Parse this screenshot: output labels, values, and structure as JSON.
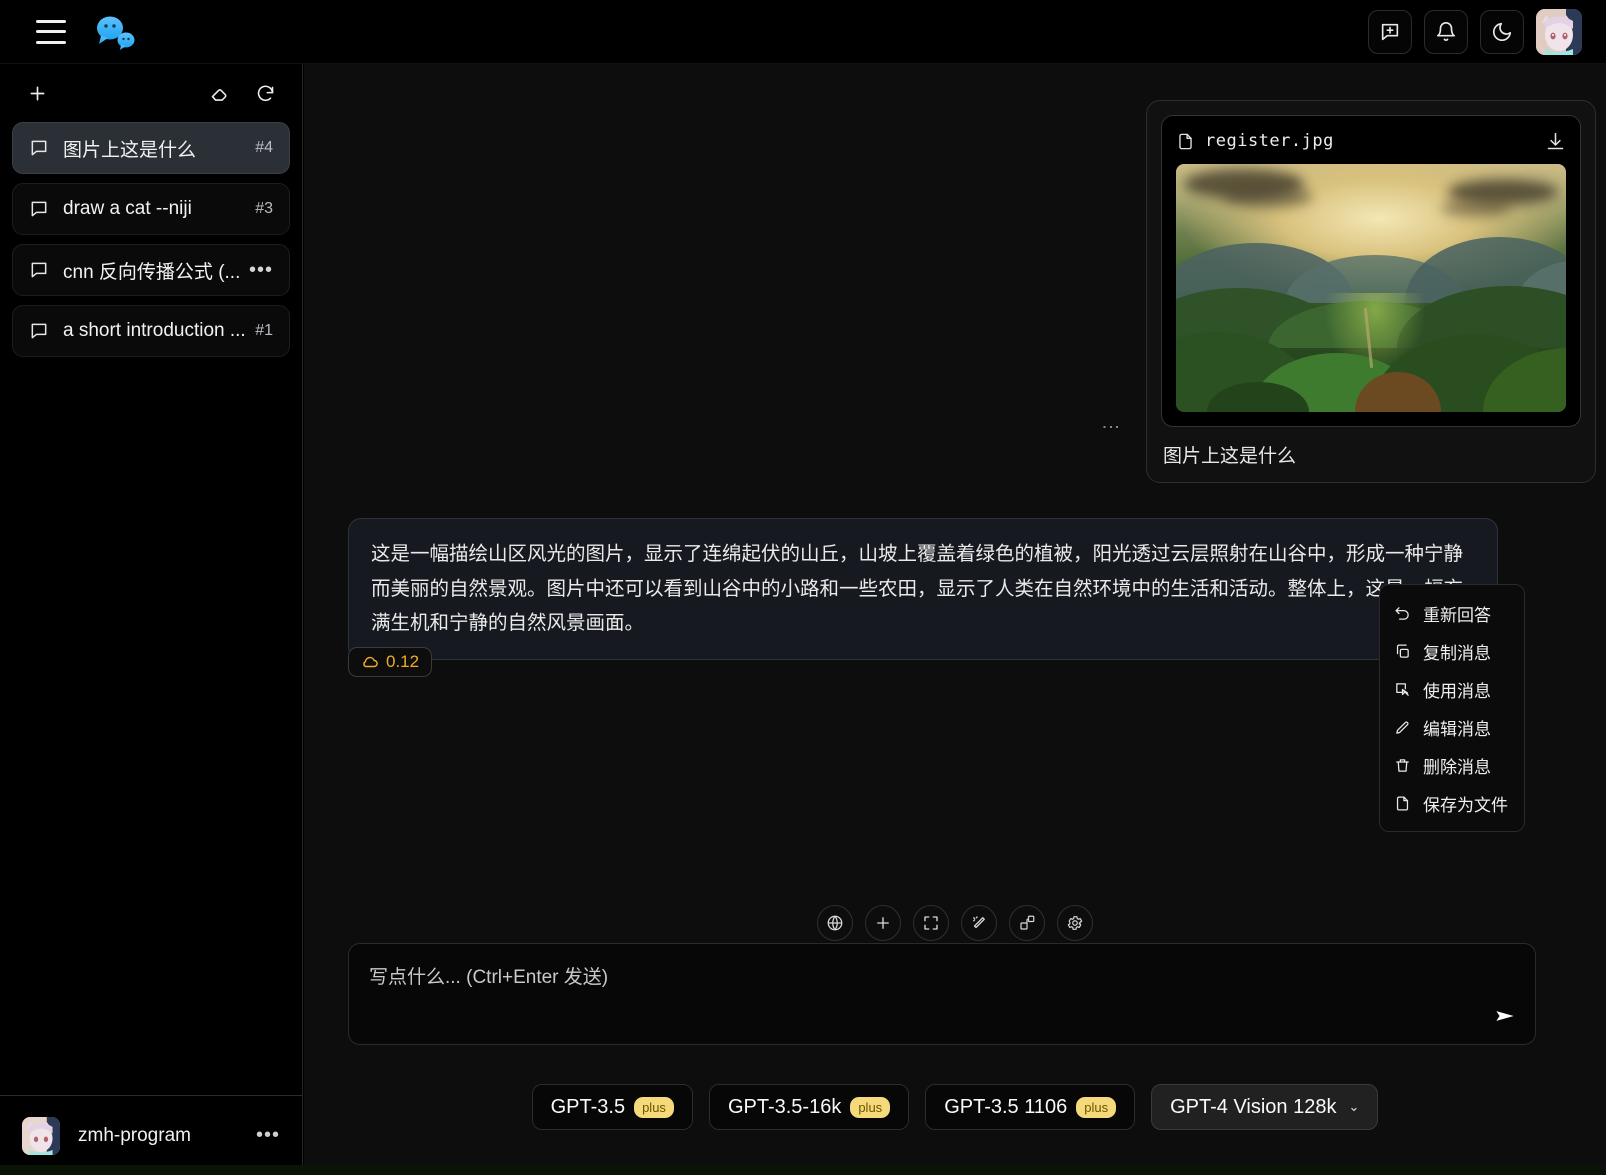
{
  "header": {
    "menu_icon": "hamburger-icon",
    "logo_icon": "chat-bubbles-logo",
    "buttons": [
      {
        "name": "new-chat-button",
        "icon": "message-plus-icon"
      },
      {
        "name": "notifications-button",
        "icon": "bell-icon"
      },
      {
        "name": "theme-toggle-button",
        "icon": "moon-icon"
      }
    ],
    "avatar_name": "user-avatar"
  },
  "sidebar": {
    "new_chat_icon": "plus-icon",
    "clear_icon": "eraser-icon",
    "refresh_icon": "refresh-icon",
    "conversations": [
      {
        "title": "图片上这是什么",
        "badge": "#4",
        "active": true,
        "menu": ""
      },
      {
        "title": "draw a cat --niji",
        "badge": "#3",
        "active": false,
        "menu": ""
      },
      {
        "title": "cnn 反向传播公式 (...",
        "badge": "",
        "active": false,
        "menu": "•••"
      },
      {
        "title": "a short introduction ...",
        "badge": "#1",
        "active": false,
        "menu": ""
      }
    ],
    "user": {
      "name": "zmh-program",
      "menu": "•••"
    }
  },
  "conversation": {
    "user_message": {
      "file_name": "register.jpg",
      "file_icon": "file-icon",
      "download_icon": "download-icon",
      "caption": "图片上这是什么",
      "kebab": "⋮"
    },
    "assistant_message": {
      "text": "这是一幅描绘山区风光的图片，显示了连绵起伏的山丘，山坡上覆盖着绿色的植被，阳光透过云层照射在山谷中，形成一种宁静而美丽的自然景观。图片中还可以看到山谷中的小路和一些农田，显示了人类在自然环境中的生活和活动。整体上，这是一幅充满生机和宁静的自然风景画面。",
      "cost_value": "0.12",
      "cost_icon": "cloud-icon",
      "cost_color": "#f0ad22",
      "kebab": "⋮"
    }
  },
  "context_menu": {
    "items": [
      {
        "label": "重新回答",
        "icon": "undo-icon"
      },
      {
        "label": "复制消息",
        "icon": "copy-icon"
      },
      {
        "label": "使用消息",
        "icon": "cursor-box-icon"
      },
      {
        "label": "编辑消息",
        "icon": "pencil-icon"
      },
      {
        "label": "删除消息",
        "icon": "trash-icon"
      },
      {
        "label": "保存为文件",
        "icon": "file-icon"
      }
    ]
  },
  "input_toolbar": {
    "buttons": [
      {
        "name": "web-search-toggle",
        "icon": "globe-icon"
      },
      {
        "name": "add-attachment-button",
        "icon": "plus-icon"
      },
      {
        "name": "fullscreen-button",
        "icon": "maximize-icon"
      },
      {
        "name": "magic-prompt-button",
        "icon": "magic-wand-icon"
      },
      {
        "name": "plugins-button",
        "icon": "blocks-icon"
      },
      {
        "name": "settings-button",
        "icon": "gear-icon"
      }
    ]
  },
  "composer": {
    "placeholder": "写点什么... (Ctrl+Enter 发送)",
    "value": "",
    "send_icon": "send-icon"
  },
  "model_bar": {
    "models": [
      {
        "name": "GPT-3.5",
        "badge": "plus",
        "selected": false,
        "chevron": ""
      },
      {
        "name": "GPT-3.5-16k",
        "badge": "plus",
        "selected": false,
        "chevron": ""
      },
      {
        "name": "GPT-3.5 1106",
        "badge": "plus",
        "selected": false,
        "chevron": ""
      },
      {
        "name": "GPT-4 Vision 128k",
        "badge": "",
        "selected": true,
        "chevron": "⌄"
      }
    ]
  },
  "theme": {
    "accent": "#3fb0f7",
    "badge_yellow": "#f5d97a",
    "bg": "#000000",
    "main_bg": "#0d0d0d"
  }
}
